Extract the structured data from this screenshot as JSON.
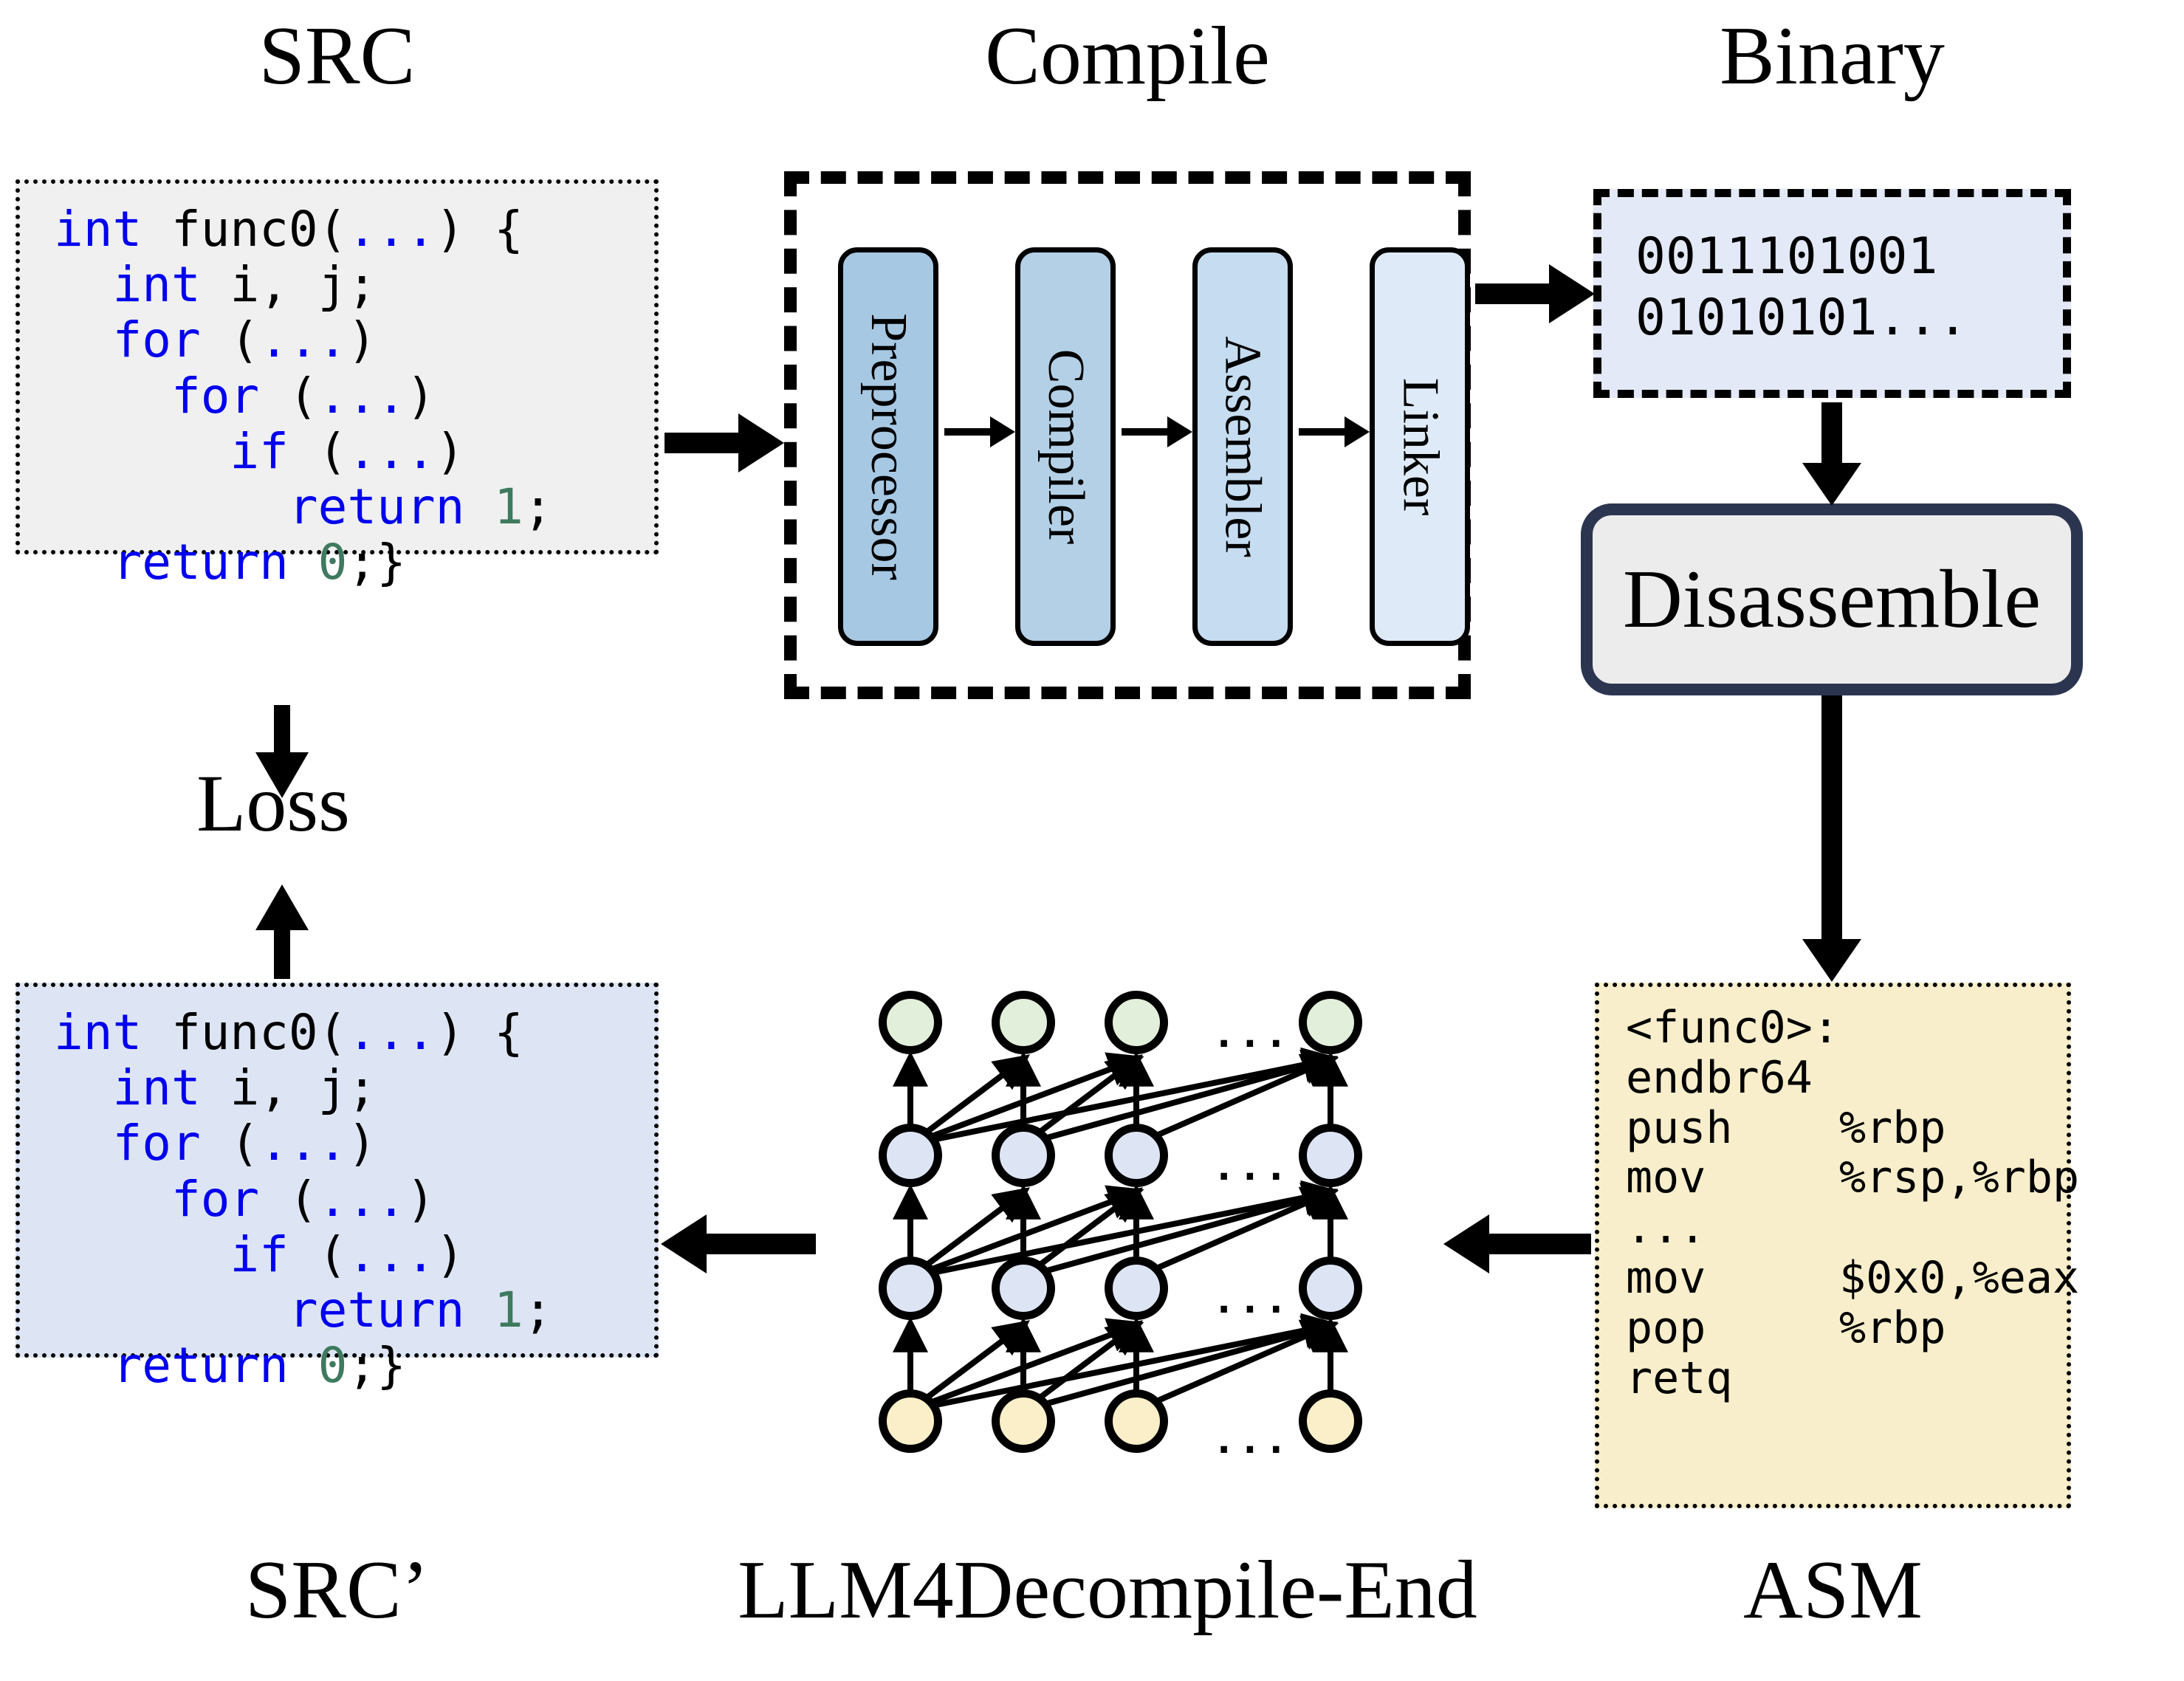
{
  "titles": {
    "src": "SRC",
    "compile": "Compile",
    "binary": "Binary",
    "srcp": "SRC’",
    "model": "LLM4Decompile-End",
    "asm": "ASM",
    "loss": "Loss"
  },
  "src_code": {
    "lines": [
      {
        "indent": 0,
        "parts": [
          {
            "t": "int ",
            "c": "kw"
          },
          {
            "t": "func0(",
            "c": ""
          },
          {
            "t": "...",
            "c": "kw"
          },
          {
            "t": ") {",
            "c": ""
          }
        ]
      },
      {
        "indent": 1,
        "parts": [
          {
            "t": "int ",
            "c": "kw"
          },
          {
            "t": "i, j;",
            "c": ""
          }
        ]
      },
      {
        "indent": 1,
        "parts": [
          {
            "t": "for ",
            "c": "kw"
          },
          {
            "t": "(",
            "c": ""
          },
          {
            "t": "...",
            "c": "kw"
          },
          {
            "t": ")",
            "c": ""
          }
        ]
      },
      {
        "indent": 2,
        "parts": [
          {
            "t": "for ",
            "c": "kw"
          },
          {
            "t": "(",
            "c": ""
          },
          {
            "t": "...",
            "c": "kw"
          },
          {
            "t": ")",
            "c": ""
          }
        ]
      },
      {
        "indent": 3,
        "parts": [
          {
            "t": "if ",
            "c": "kw"
          },
          {
            "t": "(",
            "c": ""
          },
          {
            "t": "...",
            "c": "kw"
          },
          {
            "t": ")",
            "c": ""
          }
        ]
      },
      {
        "indent": 4,
        "parts": [
          {
            "t": "return ",
            "c": "kw"
          },
          {
            "t": "1",
            "c": "num"
          },
          {
            "t": ";",
            "c": ""
          }
        ]
      },
      {
        "indent": 1,
        "parts": [
          {
            "t": "return ",
            "c": "kw"
          },
          {
            "t": "0",
            "c": "num"
          },
          {
            "t": ";}",
            "c": ""
          }
        ]
      }
    ],
    "plain": "int func0(...) {\n  int i, j;\n  for (...)\n    for (...)\n      if (...)\n        return 1;\n  return 0;}"
  },
  "srcp_code": {
    "plain": "int func0(...) {\n  int i, j;\n  for (...)\n    for (...)\n      if (...)\n        return 1;\n  return 0;}"
  },
  "binary": {
    "line1": "0011101001",
    "line2": "01010101...",
    "text": "0011101001\n01010101..."
  },
  "asm": {
    "label": "<func0>:",
    "instructions": [
      {
        "mnemonic": "endbr64",
        "operands": ""
      },
      {
        "mnemonic": "push",
        "operands": "%rbp"
      },
      {
        "mnemonic": "mov",
        "operands": "%rsp,%rbp"
      },
      {
        "mnemonic": "...",
        "operands": ""
      },
      {
        "mnemonic": "mov",
        "operands": "$0x0,%eax"
      },
      {
        "mnemonic": "pop",
        "operands": "%rbp"
      },
      {
        "mnemonic": "retq",
        "operands": ""
      }
    ],
    "text": "<func0>:\nendbr64\npush    %rbp\nmov     %rsp,%rbp\n...\nmov     $0x0,%eax\npop     %rbp\nretq"
  },
  "compile_stages": [
    {
      "label": "Preprocessor",
      "color": "#a6c8e3"
    },
    {
      "label": "Compiler",
      "color": "#b3d0e6"
    },
    {
      "label": "Assembler",
      "color": "#c6dcf0"
    },
    {
      "label": "Linker",
      "color": "#dfeaf8"
    }
  ],
  "disassemble": {
    "label": "Disassemble",
    "border_color": "#2c3550",
    "fill": "#ececec"
  },
  "network": {
    "ellipsis": "...",
    "layers": [
      {
        "name": "input-layer",
        "color": "#faefc8"
      },
      {
        "name": "hidden-layer-1",
        "color": "#dde5f5"
      },
      {
        "name": "hidden-layer-2",
        "color": "#dde5f5"
      },
      {
        "name": "output-layer",
        "color": "#e2efda"
      }
    ],
    "columns": 4
  },
  "colors": {
    "src_fill": "#eff0ef",
    "srcp_fill": "#dde5f5",
    "binary_fill": "#e3e9f7",
    "asm_fill": "#f8eecb",
    "keyword": "#0000ee",
    "number": "#3e7a5e"
  }
}
